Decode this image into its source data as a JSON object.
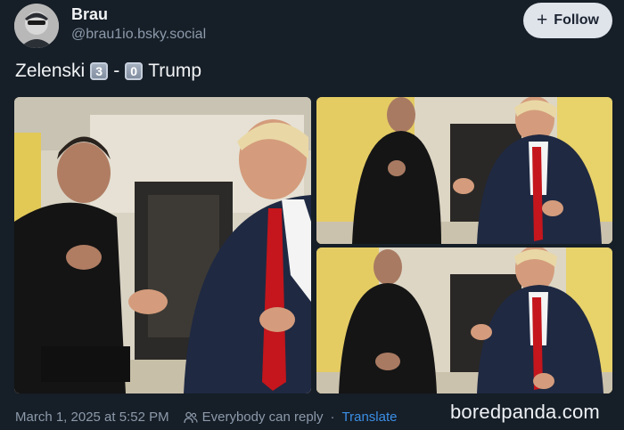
{
  "author": {
    "display_name": "Brau",
    "handle": "@brau1io.bsky.social"
  },
  "follow_button": {
    "label": "Follow"
  },
  "post": {
    "text_before": "Zelenski",
    "score_left": "3",
    "dash": "-",
    "score_right": "0",
    "text_after": "Trump"
  },
  "footer": {
    "timestamp": "March 1, 2025 at 5:52 PM",
    "reply_setting": "Everybody can reply",
    "separator": "·",
    "translate_label": "Translate"
  },
  "watermark": "boredpanda.com",
  "icons": {
    "follow": "plus-icon",
    "reply": "people-icon"
  },
  "colors": {
    "background": "#161e27",
    "follow_button_bg": "#dfe3ea",
    "link": "#3b8fe6",
    "muted_text": "#8c9aab"
  }
}
